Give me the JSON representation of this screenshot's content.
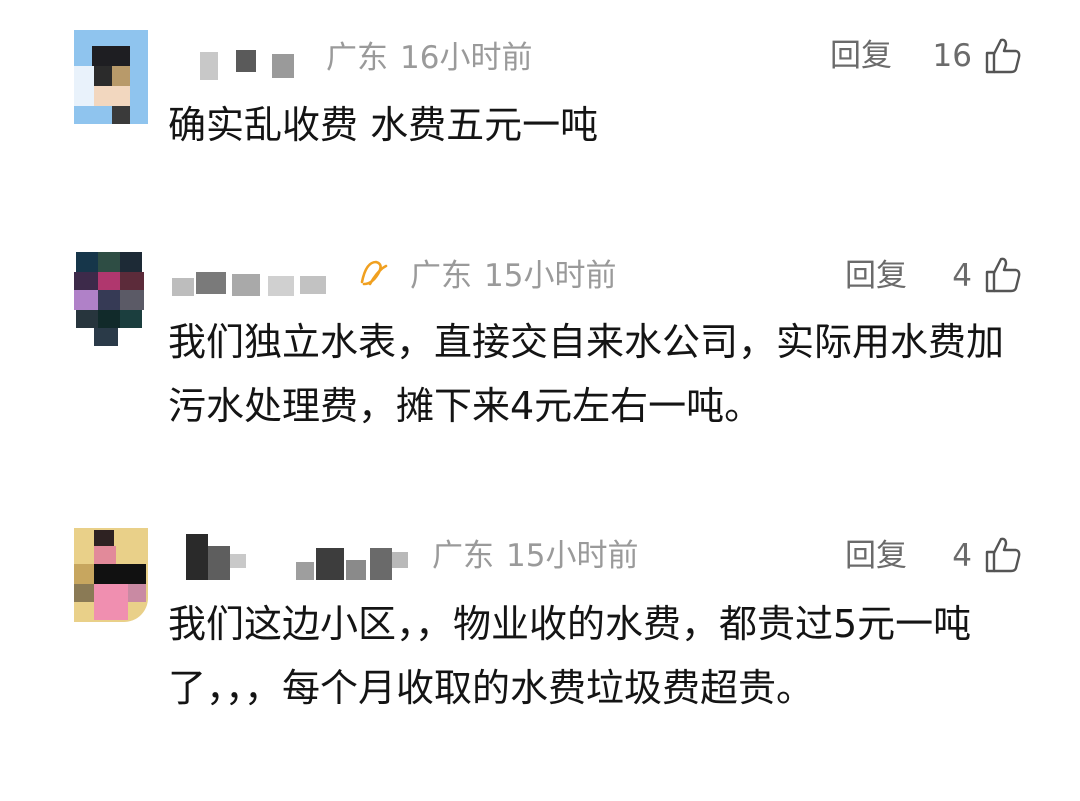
{
  "comments": [
    {
      "location": "广东",
      "time": "16小时前",
      "reply_label": "回复",
      "likes": "16",
      "text": "确实乱收费 水费五元一吨"
    },
    {
      "location": "广东",
      "time": "15小时前",
      "reply_label": "回复",
      "likes": "4",
      "text": "我们独立水表，直接交自来水公司，实际用水费加污水处理费，摊下来4元左右一吨。"
    },
    {
      "location": "广东",
      "time": "15小时前",
      "reply_label": "回复",
      "likes": "4",
      "text": "我们这边小区，，物业收的水费，都贵过5元一吨了，，，每个月收取的水费垃圾费超贵。"
    }
  ],
  "icons": {
    "like": "thumbs-up-icon",
    "badge": "fan-badge-icon"
  },
  "colors": {
    "meta_text": "#9a9a9a",
    "action_text": "#6b6b6b",
    "body_text": "#141414",
    "badge": "#f0a020"
  }
}
